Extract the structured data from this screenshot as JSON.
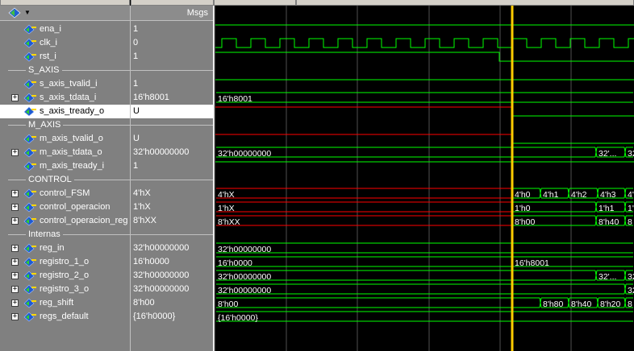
{
  "header": {
    "values_title": "Msgs"
  },
  "colors": {
    "green": "#00ff00",
    "red": "#ff0000",
    "cursor": "#ffcc00",
    "grid": "#505050"
  },
  "rows": [
    {
      "type": "sig",
      "name": "ena_i",
      "value": "1",
      "expand": false
    },
    {
      "type": "sig",
      "name": "clk_i",
      "value": "0",
      "expand": false
    },
    {
      "type": "sig",
      "name": "rst_i",
      "value": "1",
      "expand": false
    },
    {
      "type": "group",
      "name": "S_AXIS"
    },
    {
      "type": "sig",
      "name": "s_axis_tvalid_i",
      "value": "1",
      "expand": false
    },
    {
      "type": "sig",
      "name": "s_axis_tdata_i",
      "value": "16'h8001",
      "expand": true
    },
    {
      "type": "sig",
      "name": "s_axis_tready_o",
      "value": "U",
      "expand": false,
      "selected": true
    },
    {
      "type": "group",
      "name": "M_AXIS"
    },
    {
      "type": "sig",
      "name": "m_axis_tvalid_o",
      "value": "U",
      "expand": false
    },
    {
      "type": "sig",
      "name": "m_axis_tdata_o",
      "value": "32'h00000000",
      "expand": true
    },
    {
      "type": "sig",
      "name": "m_axis_tready_i",
      "value": "1",
      "expand": false
    },
    {
      "type": "group",
      "name": "CONTROL"
    },
    {
      "type": "sig",
      "name": "control_FSM",
      "value": "4'hX",
      "expand": true
    },
    {
      "type": "sig",
      "name": "control_operacion",
      "value": "1'hX",
      "expand": true
    },
    {
      "type": "sig",
      "name": "control_operacion_reg",
      "value": "8'hXX",
      "expand": true
    },
    {
      "type": "group",
      "name": "Internas"
    },
    {
      "type": "sig",
      "name": "reg_in",
      "value": "32'h00000000",
      "expand": true
    },
    {
      "type": "sig",
      "name": "registro_1_o",
      "value": "16'h0000",
      "expand": true
    },
    {
      "type": "sig",
      "name": "registro_2_o",
      "value": "32'h00000000",
      "expand": true
    },
    {
      "type": "sig",
      "name": "registro_3_o",
      "value": "32'h00000000",
      "expand": true
    },
    {
      "type": "sig",
      "name": "reg_shift",
      "value": "8'h00",
      "expand": true
    },
    {
      "type": "sig",
      "name": "regs_default",
      "value": "{16'h0000}",
      "expand": true
    }
  ],
  "wave_labels": {
    "s_axis_tdata_i": [
      "16'h8001"
    ],
    "m_axis_tdata_o": [
      "32'h00000000",
      "32'...",
      "32"
    ],
    "control_FSM": [
      "4'hX",
      "4'h0",
      "4'h1",
      "4'h2",
      "4'h3",
      "4'"
    ],
    "control_operacion": [
      "1'hX",
      "1'h0",
      "1'h1",
      "1'"
    ],
    "control_operacion_reg": [
      "8'hXX",
      "8'h00",
      "8'h40",
      "8"
    ],
    "reg_in": [
      "32'h00000000"
    ],
    "registro_1_o": [
      "16'h0000",
      "16'h8001"
    ],
    "registro_2_o": [
      "32'h00000000",
      "32'...",
      "32"
    ],
    "registro_3_o": [
      "32'h00000000",
      "32"
    ],
    "reg_shift": [
      "8'h00",
      "8'h80",
      "8'h40",
      "8'h20",
      "8"
    ],
    "regs_default": [
      "{16'h0000}"
    ]
  }
}
